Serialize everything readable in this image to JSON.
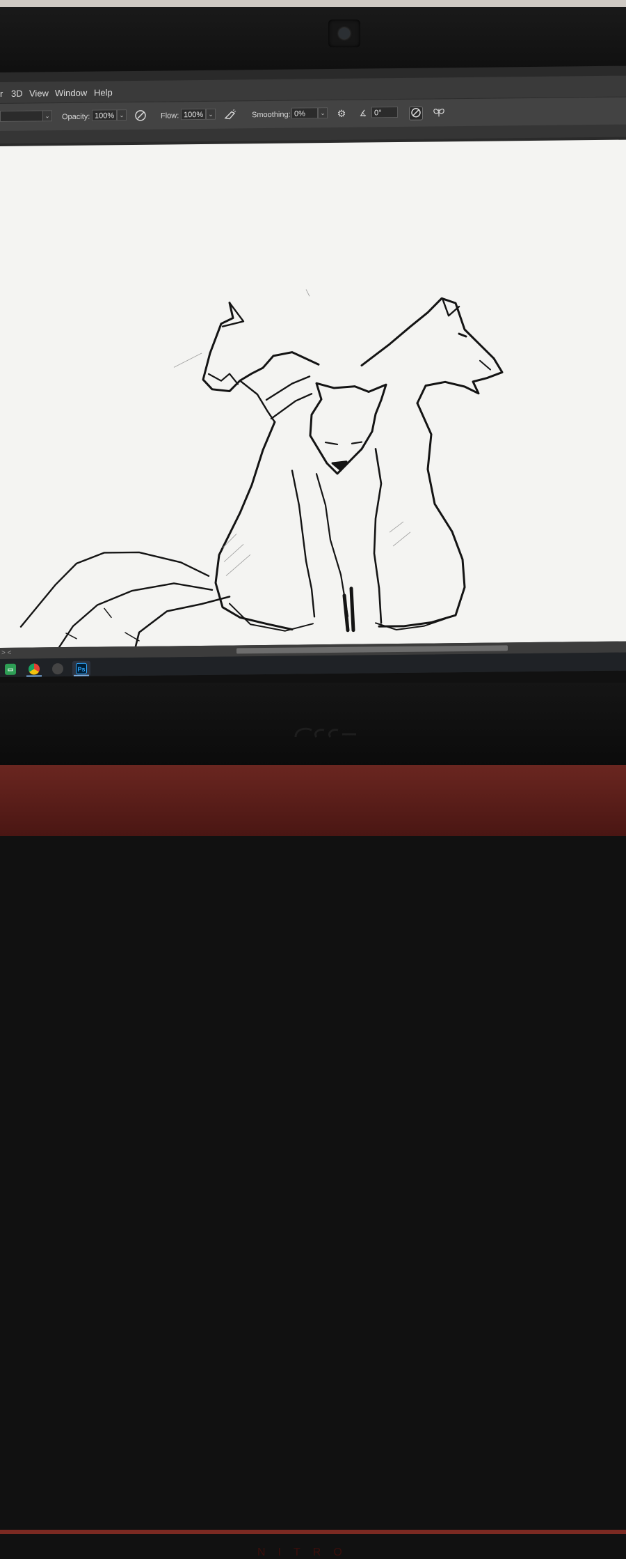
{
  "menubar": {
    "items": [
      "r",
      "3D",
      "View",
      "Window",
      "Help"
    ]
  },
  "options_bar": {
    "opacity_label": "Opacity:",
    "opacity_value": "100%",
    "flow_label": "Flow:",
    "flow_value": "100%",
    "smoothing_label": "Smoothing:",
    "smoothing_value": "0%",
    "angle_value": "0°",
    "icons": [
      "pressure-opacity-icon",
      "airbrush-icon",
      "smoothing-gear-icon",
      "angle-icon",
      "pressure-size-icon",
      "symmetry-butterfly-icon"
    ]
  },
  "scrollbar": {
    "arrows": "> <"
  },
  "taskbar": {
    "items": [
      {
        "name": "app-tile-icon",
        "color": "#2e9e55"
      },
      {
        "name": "chrome-icon",
        "color": "#e34133"
      },
      {
        "name": "window-switch-icon",
        "color": "#666666"
      },
      {
        "name": "photoshop-icon",
        "label": "Ps",
        "color": "#31a8ff"
      }
    ]
  },
  "hardware": {
    "brand_text": "NITRO"
  },
  "colors": {
    "canvas": "#f4f4f2",
    "ink": "#111111",
    "photoshop_ui": "#434343"
  }
}
